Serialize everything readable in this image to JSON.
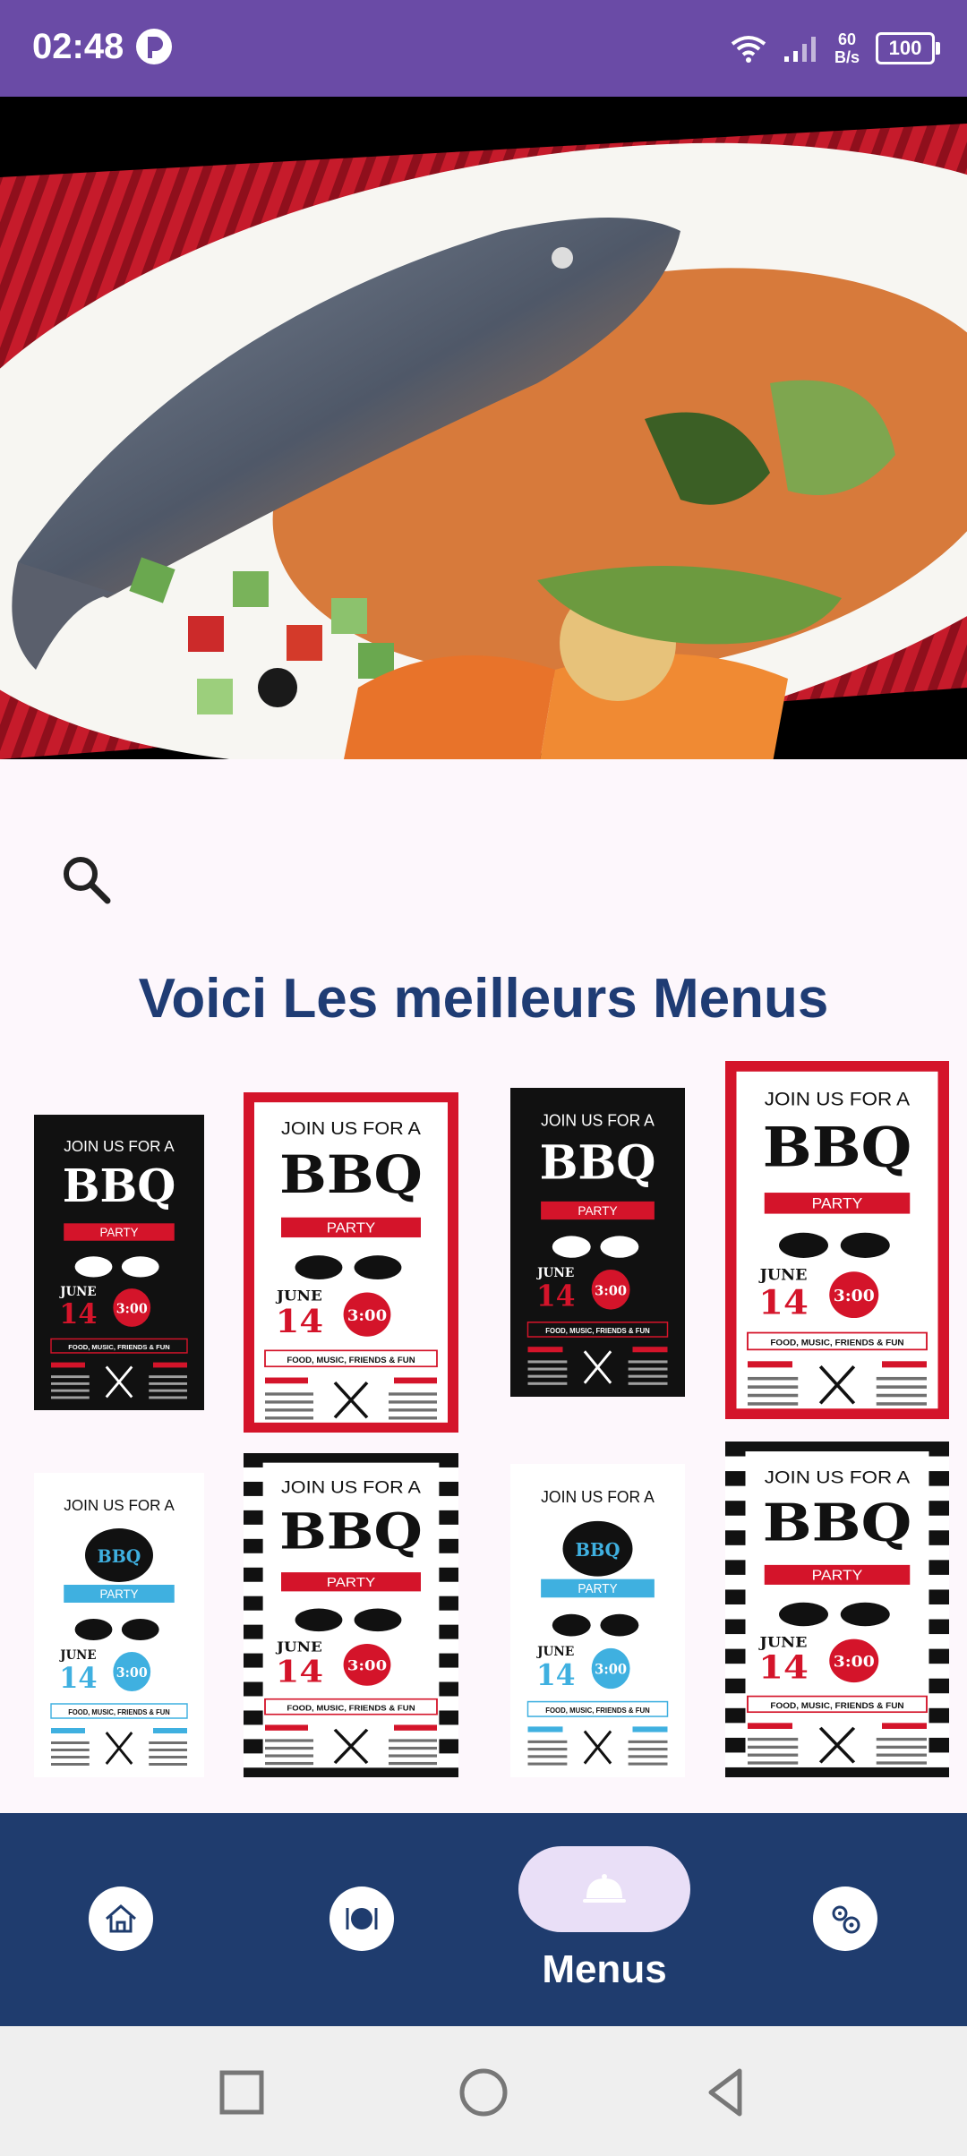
{
  "status_bar": {
    "time": "02:48",
    "net_speed_value": "60",
    "net_speed_unit": "B/s",
    "battery": "100",
    "color": "#6a4ba6"
  },
  "hero": {
    "image_icon": "grilled-fish-couscous-photo"
  },
  "search": {
    "icon": "search-icon"
  },
  "section": {
    "title": "Voici Les meilleurs Menus"
  },
  "menus": [
    {
      "top_line": "JOIN US FOR A",
      "headline": "BBQ",
      "banner": "PARTY",
      "month": "JUNE",
      "day": "14",
      "time": "3:00",
      "footer": "FOOD, MUSIC, FRIENDS & FUN"
    },
    {
      "top_line": "JOIN US FOR A",
      "headline": "BBQ",
      "banner": "PARTY",
      "month": "JUNE",
      "day": "14",
      "time": "3:00",
      "footer": "FOOD, MUSIC, FRIENDS & FUN"
    },
    {
      "top_line": "JOIN US FOR A",
      "headline": "BBQ",
      "banner": "PARTY",
      "month": "JUNE",
      "day": "14",
      "time": "3:00",
      "footer": "FOOD, MUSIC, FRIENDS & FUN"
    },
    {
      "top_line": "JOIN US FOR A",
      "headline": "BBQ",
      "banner": "PARTY",
      "month": "JUNE",
      "day": "14",
      "time": "3:00",
      "footer": "FOOD, MUSIC, FRIENDS & FUN"
    },
    {
      "top_line": "JOIN US FOR A",
      "headline": "BBQ",
      "banner": "PARTY",
      "month": "JUNE",
      "day": "14",
      "time": "3:00",
      "footer": "FOOD, MUSIC, FRIENDS & FUN"
    },
    {
      "top_line": "JOIN US FOR A",
      "headline": "BBQ",
      "banner": "PARTY",
      "month": "JUNE",
      "day": "14",
      "time": "3:00",
      "footer": "FOOD, MUSIC, FRIENDS & FUN"
    },
    {
      "top_line": "JOIN US FOR A",
      "headline": "BBQ",
      "banner": "PARTY",
      "month": "JUNE",
      "day": "14",
      "time": "3:00",
      "footer": "FOOD, MUSIC, FRIENDS & FUN"
    },
    {
      "top_line": "JOIN US FOR A",
      "headline": "BBQ",
      "banner": "PARTY",
      "month": "JUNE",
      "day": "14",
      "time": "3:00",
      "footer": "FOOD, MUSIC, FRIENDS & FUN"
    }
  ],
  "bottom_nav": {
    "items": [
      {
        "icon": "home-icon"
      },
      {
        "icon": "restaurant-icon"
      },
      {
        "icon": "cloche-icon",
        "label": "Menus",
        "active": true
      },
      {
        "icon": "settings-icon"
      }
    ],
    "background": "#1f3c6e",
    "active_pill": "#e9dff7"
  },
  "system_nav": {
    "icons": [
      "recents-icon",
      "home-circle-icon",
      "back-icon"
    ]
  }
}
